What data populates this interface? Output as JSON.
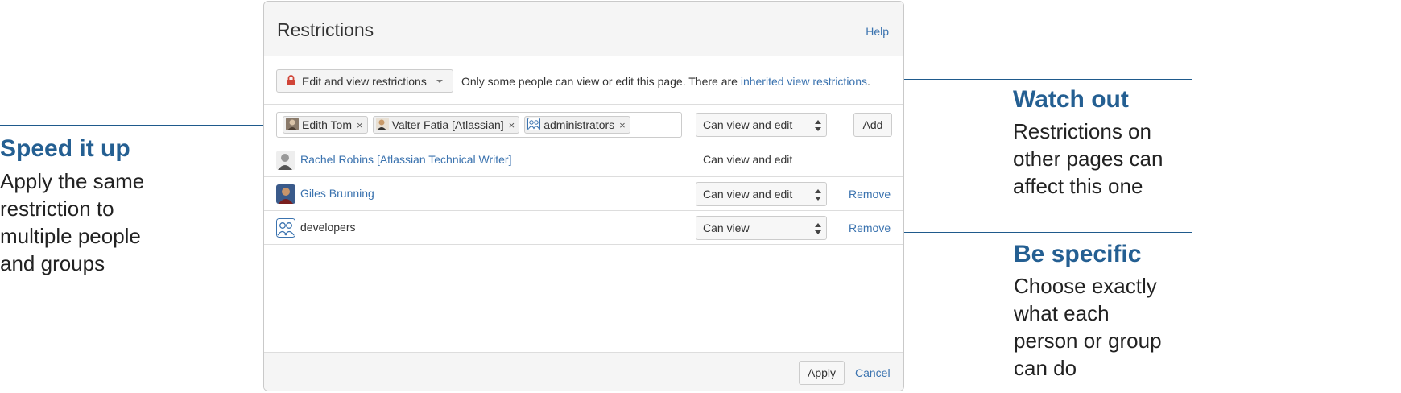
{
  "dialog": {
    "title": "Restrictions",
    "help": "Help",
    "mode_button": "Edit and view restrictions",
    "restriction_text": "Only some people can view or edit this page. There are ",
    "restriction_link": "inherited view restrictions",
    "restriction_suffix": "."
  },
  "picker": {
    "chips": [
      {
        "label": "Edith Tom",
        "icon": "user-avatar"
      },
      {
        "label": "Valter Fatia [Atlassian]",
        "icon": "user-avatar"
      },
      {
        "label": "administrators",
        "icon": "group-icon"
      }
    ],
    "remove_glyph": "×",
    "permission": "Can view and edit",
    "add_label": "Add"
  },
  "entries": [
    {
      "name": "Rachel Robins [Atlassian Technical Writer]",
      "permission": "Can view and edit",
      "icon": "user-avatar"
    },
    {
      "name": "Giles Brunning",
      "permission": "Can view and edit",
      "remove": "Remove",
      "icon": "user-avatar"
    },
    {
      "name": "developers",
      "permission": "Can view",
      "remove": "Remove",
      "icon": "group-icon"
    }
  ],
  "footer": {
    "apply": "Apply",
    "cancel": "Cancel"
  },
  "callouts": {
    "speed": {
      "title": "Speed it up",
      "body": [
        "Apply the same",
        "restriction to",
        "multiple people",
        "and groups"
      ]
    },
    "watch": {
      "title": "Watch out",
      "body": [
        "Restrictions on",
        "other pages can",
        "affect this one"
      ]
    },
    "specific": {
      "title": "Be specific",
      "body": [
        "Choose exactly",
        "what each",
        "person or group",
        "can do"
      ]
    }
  },
  "colors": {
    "link": "#3b73af",
    "callout_title": "#245f92",
    "lock": "#d04437"
  }
}
